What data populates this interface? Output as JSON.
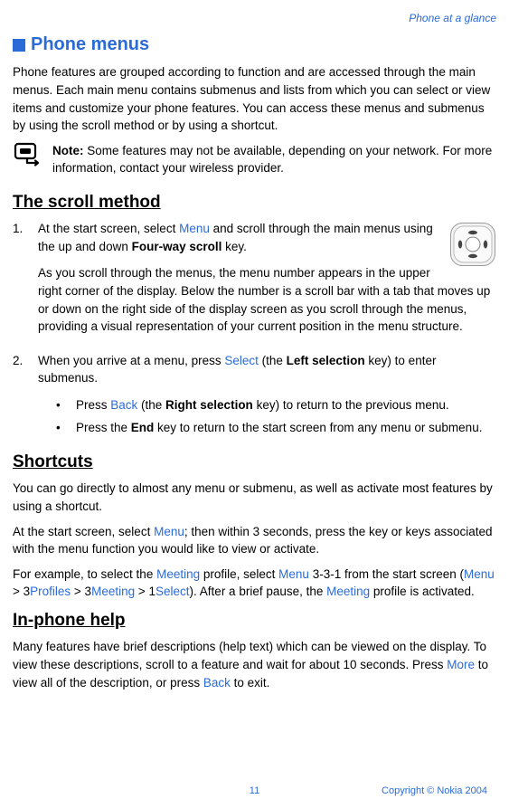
{
  "header": {
    "section_name": "Phone at a glance"
  },
  "title": {
    "heading": "Phone menus"
  },
  "intro": "Phone features are grouped according to function and are accessed through the main menus. Each main menu contains submenus and lists from which you can select or view items and customize your phone features. You can access these menus and submenus by using the scroll method or by using a shortcut.",
  "note": {
    "label": "Note:",
    "text": " Some features may not be available, depending on your network. For more information, contact your wireless provider."
  },
  "scroll": {
    "heading": "The scroll method",
    "step1_a": "At the start screen, select ",
    "step1_menu": "Menu",
    "step1_b": " and scroll through the main menus using the up and down ",
    "step1_key": "Four-way scroll",
    "step1_c": " key.",
    "step1_p2": "As you scroll through the menus, the menu number appears in the upper right corner of the display. Below the number is a scroll bar with a tab that moves up or down on the right side of the display screen as you scroll through the menus, providing a visual representation of your current position in the menu structure.",
    "step2_a": "When you arrive at a menu, press ",
    "step2_select": "Select",
    "step2_b": " (the ",
    "step2_key": "Left selection",
    "step2_c": " key) to enter submenus.",
    "bullet1_a": "Press ",
    "bullet1_back": "Back",
    "bullet1_b": " (the ",
    "bullet1_key": "Right selection",
    "bullet1_c": " key) to return to the previous menu.",
    "bullet2_a": "Press the ",
    "bullet2_key": "End",
    "bullet2_b": " key to return to the start screen from any menu or submenu."
  },
  "shortcuts": {
    "heading": "Shortcuts",
    "p1": "You can go directly to almost any menu or submenu, as well as activate most features by using a shortcut.",
    "p2_a": "At the start screen, select ",
    "p2_menu": "Menu",
    "p2_b": "; then within 3 seconds, press the key or keys associated with the menu function you would like to view or activate.",
    "p3_a": "For example, to select the ",
    "p3_meeting1": "Meeting",
    "p3_b": " profile, select ",
    "p3_menu2": "Menu",
    "p3_c": " 3-3-1 from the start screen (",
    "p3_menu3": "Menu",
    "p3_d": " > 3",
    "p3_profiles": "Profiles",
    "p3_e": " > 3",
    "p3_meeting2": "Meeting",
    "p3_f": " > 1",
    "p3_select": "Select",
    "p3_g": "). After a brief pause, the ",
    "p3_meeting3": "Meeting",
    "p3_h": " profile is activated."
  },
  "help": {
    "heading": "In-phone help",
    "p1_a": "Many features have brief descriptions (help text) which can be viewed on the display. To view these descriptions, scroll to a feature and wait for about 10 seconds. Press ",
    "p1_more": "More",
    "p1_b": " to view all of the description, or press ",
    "p1_back": "Back",
    "p1_c": " to exit."
  },
  "footer": {
    "page": "11",
    "copyright": "Copyright © Nokia 2004"
  }
}
